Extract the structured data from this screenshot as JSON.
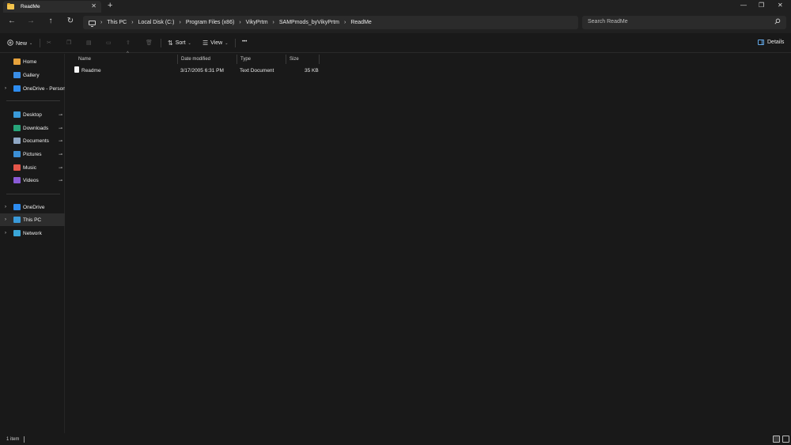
{
  "window": {
    "tab_title": "ReadMe",
    "new_tab": "+",
    "tab_close": "✕",
    "controls": {
      "minimize": "—",
      "maximize": "❐",
      "close": "✕"
    }
  },
  "nav": {
    "back": "←",
    "forward": "→",
    "up": "↑",
    "refresh": "↻",
    "breadcrumb": [
      "This PC",
      "Local Disk (C:)",
      "Program Files (x86)",
      "VikyPrtm",
      "SAMPmods_byVikyPrtm",
      "ReadMe"
    ],
    "separator": "›",
    "search_placeholder": "Search ReadMe",
    "search_icon": "search-icon"
  },
  "toolbar": {
    "new_label": "New",
    "sort_label": "Sort",
    "view_label": "View",
    "more_label": "•••",
    "details_label": "Details",
    "icons": [
      "cut-icon",
      "copy-icon",
      "paste-icon",
      "rename-icon",
      "share-icon",
      "delete-icon"
    ]
  },
  "sidebar": {
    "quick": [
      {
        "label": "Home",
        "color": "#e6a23c",
        "pinned": false,
        "chevron": false
      },
      {
        "label": "Gallery",
        "color": "#3a8ee6",
        "pinned": false,
        "chevron": false
      },
      {
        "label": "OneDrive - Persona",
        "color": "#2d8cf0",
        "pinned": false,
        "chevron": true
      }
    ],
    "pinned": [
      {
        "label": "Desktop",
        "color": "#3a9ad9"
      },
      {
        "label": "Downloads",
        "color": "#27a57a"
      },
      {
        "label": "Documents",
        "color": "#8fa7c4"
      },
      {
        "label": "Pictures",
        "color": "#3b8fd6"
      },
      {
        "label": "Music",
        "color": "#e4564a"
      },
      {
        "label": "Videos",
        "color": "#8a5ad6"
      }
    ],
    "drives": [
      {
        "label": "OneDrive",
        "color": "#2d8cf0",
        "selected": false
      },
      {
        "label": "This PC",
        "color": "#3a9ad9",
        "selected": true
      },
      {
        "label": "Network",
        "color": "#3aa6d8",
        "selected": false
      }
    ],
    "pin_glyph": "📌",
    "chevron_glyph": "›"
  },
  "columns": {
    "name": "Name",
    "date": "Date modified",
    "type": "Type",
    "size": "Size"
  },
  "files": [
    {
      "name": "Readme",
      "date": "3/17/2005 6:31 PM",
      "type": "Text Document",
      "size": "35 KB"
    }
  ],
  "status": {
    "count": "1 item"
  }
}
